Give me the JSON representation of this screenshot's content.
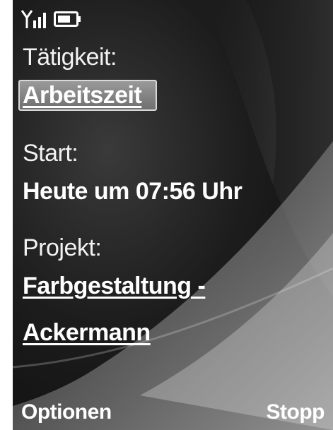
{
  "status_bar": {
    "signal_icon": "signal-bars-icon",
    "battery_icon": "battery-icon"
  },
  "fields": {
    "activity_label": "Tätigkeit:",
    "activity_value": "Arbeitszeit",
    "start_label": "Start:",
    "start_value": "Heute um 07:56 Uhr",
    "project_label": "Projekt:",
    "project_value_line1": "Farbgestaltung -",
    "project_value_line2": "Ackermann"
  },
  "softkeys": {
    "left": "Optionen",
    "right": "Stopp"
  }
}
